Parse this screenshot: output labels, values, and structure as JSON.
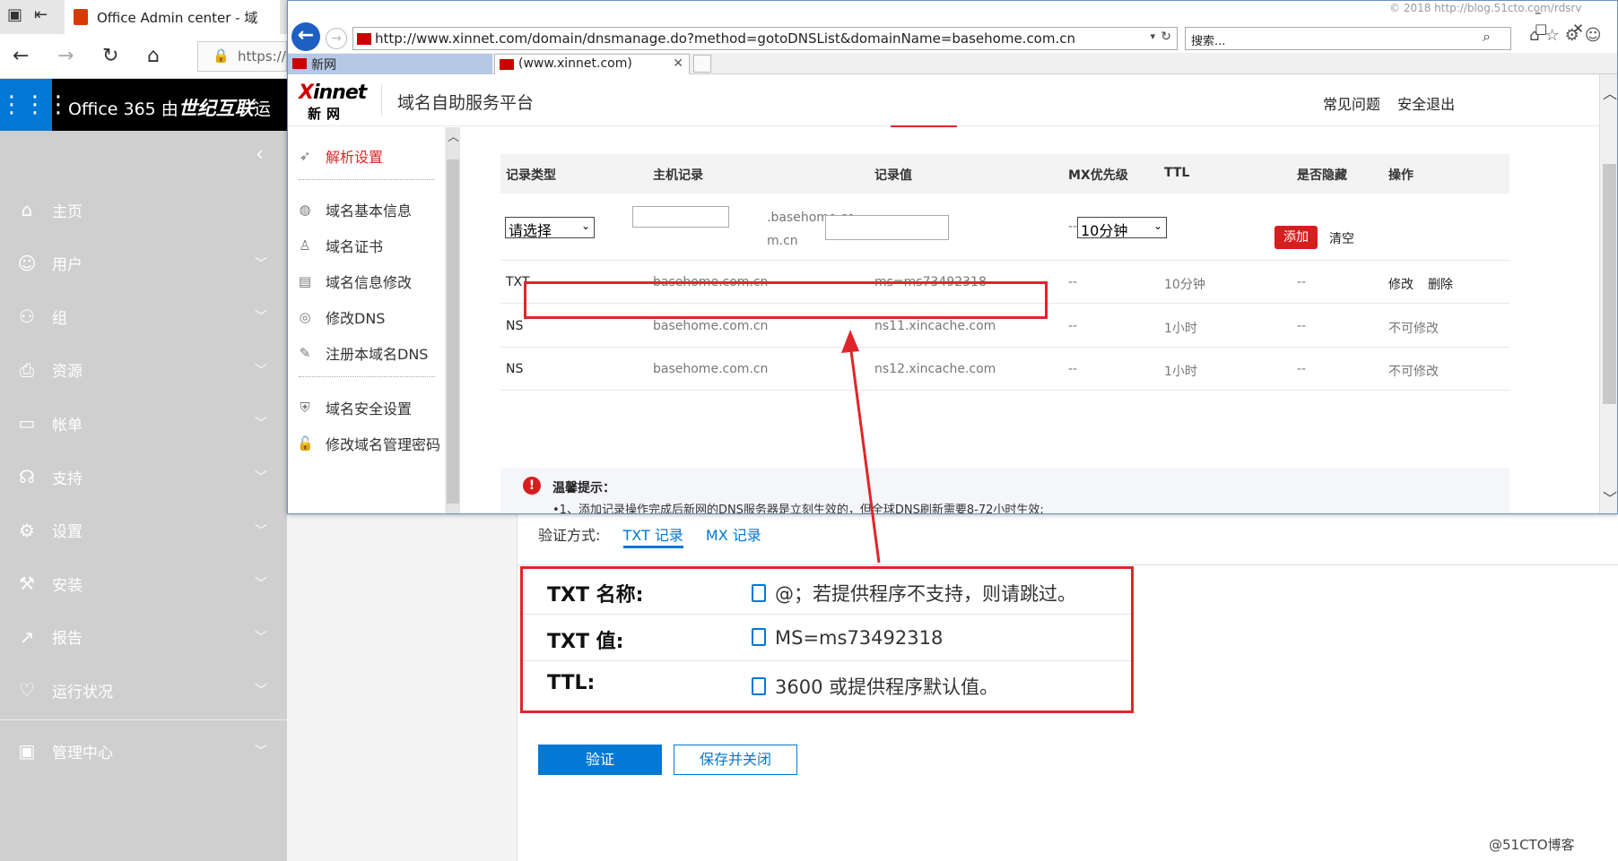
{
  "edge": {
    "tab_title": "Office Admin center - 域",
    "url_partial": "https://"
  },
  "o365": {
    "title_prefix": "Office 365 由",
    "title_brand": "世纪互联",
    "title_suffix": "运"
  },
  "sidebar": {
    "items": [
      {
        "label": "主页",
        "icon": "home-icon",
        "chevron": false
      },
      {
        "label": "用户",
        "icon": "user-icon",
        "chevron": true
      },
      {
        "label": "组",
        "icon": "group-icon",
        "chevron": true
      },
      {
        "label": "资源",
        "icon": "printer-icon",
        "chevron": true
      },
      {
        "label": "帐单",
        "icon": "card-icon",
        "chevron": true
      },
      {
        "label": "支持",
        "icon": "headset-icon",
        "chevron": true
      },
      {
        "label": "设置",
        "icon": "gear-icon",
        "chevron": true
      },
      {
        "label": "安装",
        "icon": "wrench-icon",
        "chevron": true
      },
      {
        "label": "报告",
        "icon": "chart-icon",
        "chevron": true
      },
      {
        "label": "运行状况",
        "icon": "heart-icon",
        "chevron": true
      },
      {
        "label": "管理中心",
        "icon": "admin-center-icon",
        "chevron": true
      }
    ]
  },
  "verify": {
    "method_label": "验证方式:",
    "txt_tab": "TXT 记录",
    "mx_tab": "MX 记录",
    "rows": [
      {
        "label": "TXT 名称:",
        "value": "@；若提供程序不支持，则请跳过。"
      },
      {
        "label": "TXT 值:",
        "value": "MS=ms73492318"
      },
      {
        "label": "TTL:",
        "value": "3600 或提供程序默认值。"
      }
    ],
    "verify_button": "验证",
    "save_close_button": "保存并关闭"
  },
  "watermark": "@51CTO博客",
  "ie": {
    "url": "http://www.xinnet.com/domain/dnsmanage.do?method=gotoDNSList&domainName=basehome.com.cn",
    "search_placeholder": "搜索...",
    "credit": "© 2018 http://blog.51cto.com/rdsrv",
    "tabs": [
      {
        "label": "新网"
      },
      {
        "label": "(www.xinnet.com)"
      }
    ]
  },
  "xinnet": {
    "logo_top_x": "X",
    "logo_top_rest": "innet",
    "logo_bottom": "新网",
    "platform_title": "域名自助服务平台",
    "header_links": [
      "常见问题",
      "安全退出"
    ],
    "side_items": [
      {
        "label": "解析设置",
        "icon": "paper-plane-icon"
      },
      {
        "label": "域名基本信息",
        "icon": "globe-icon"
      },
      {
        "label": "域名证书",
        "icon": "person-cert-icon"
      },
      {
        "label": "域名信息修改",
        "icon": "id-card-icon"
      },
      {
        "label": "修改DNS",
        "icon": "dns-icon"
      },
      {
        "label": "注册本域名DNS",
        "icon": "edit-icon"
      },
      {
        "label": "域名安全设置",
        "icon": "shield-icon"
      },
      {
        "label": "修改域名管理密码",
        "icon": "lock-icon"
      }
    ],
    "table": {
      "headers": [
        "记录类型",
        "主机记录",
        "记录值",
        "MX优先级",
        "TTL",
        "是否隐藏",
        "操作"
      ],
      "add_row": {
        "type_select": "请选择",
        "host_suffix": ".basehome.com.cn",
        "mx": "--",
        "ttl_select": "10分钟",
        "hidden": "--",
        "add_button": "添加",
        "clear_button": "清空"
      },
      "rows": [
        {
          "type": "TXT",
          "host": "basehome.com.cn",
          "value": "ms=ms73492318",
          "mx": "--",
          "ttl": "10分钟",
          "hidden": "--",
          "op1": "修改",
          "op2": "删除"
        },
        {
          "type": "NS",
          "host": "basehome.com.cn",
          "value": "ns11.xincache.com",
          "mx": "--",
          "ttl": "1小时",
          "hidden": "--",
          "op1": "不可修改",
          "op2": ""
        },
        {
          "type": "NS",
          "host": "basehome.com.cn",
          "value": "ns12.xincache.com",
          "mx": "--",
          "ttl": "1小时",
          "hidden": "--",
          "op1": "不可修改",
          "op2": ""
        }
      ]
    },
    "tips": {
      "title": "温馨提示：",
      "line1": "•1、添加记录操作完成后新网的DNS服务器是立刻生效的，但全球DNS刷新需要8-72小时生效;"
    }
  },
  "colors": {
    "accent_blue": "#0078d4",
    "highlight_red": "#e0252a",
    "sidebar_gray": "#cfcfcf"
  }
}
